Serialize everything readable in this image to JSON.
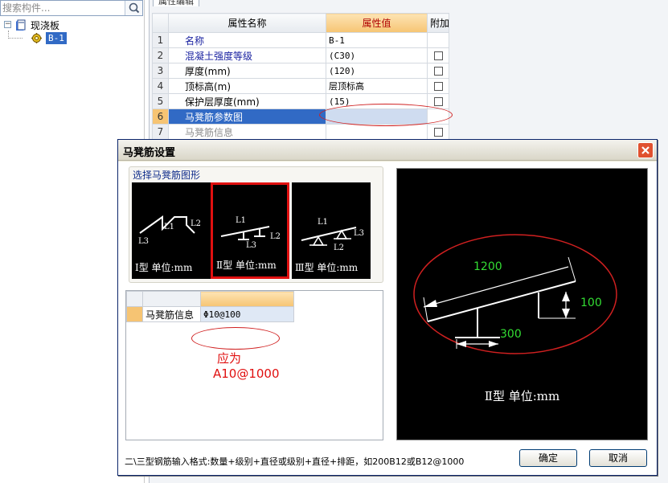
{
  "search": {
    "placeholder": "搜索构件..."
  },
  "tree": {
    "root_label": "现浇板",
    "expander": "−",
    "child_label": "B-1"
  },
  "property_panel": {
    "tab_label": "属性编辑",
    "headers": {
      "index": "",
      "name": "属性名称",
      "value": "属性值",
      "extra": "附加"
    },
    "rows": [
      {
        "index": "1",
        "name": "名称",
        "value": "B-1"
      },
      {
        "index": "2",
        "name": "混凝土强度等级",
        "value": "(C30)"
      },
      {
        "index": "3",
        "name": "厚度(mm)",
        "value": "(120)"
      },
      {
        "index": "4",
        "name": "顶标高(m)",
        "value": "层顶标高"
      },
      {
        "index": "5",
        "name": "保护层厚度(mm)",
        "value": "(15)"
      },
      {
        "index": "6",
        "name": "马凳筋参数图",
        "value": ""
      },
      {
        "index": "7",
        "name": "马凳筋信息",
        "value": ""
      }
    ]
  },
  "dialog": {
    "title": "马凳筋设置",
    "group_label": "选择马凳筋图形",
    "shapes": [
      {
        "caption": "Ⅰ型 单位:mm",
        "l1": "L1",
        "l2": "L2",
        "l3": "L3"
      },
      {
        "caption": "Ⅱ型 单位:mm",
        "l1": "L1",
        "l2": "L2",
        "l3": "L3"
      },
      {
        "caption": "Ⅲ型 单位:mm",
        "l1": "L1",
        "l2": "L2",
        "l3": "L3"
      }
    ],
    "selected_shape": 1,
    "grid": {
      "row_label": "马凳筋信息",
      "row_value": "Φ10@100"
    },
    "annotation": {
      "line1": "应为",
      "line2": "A10@1000"
    },
    "preview": {
      "caption": "Ⅱ型 单位:mm",
      "dim_length": "1200",
      "dim_height": "100",
      "dim_base": "300"
    },
    "hint": "二\\三型钢筋输入格式:数量+级别+直径或级别+直径+排距，如200B12或B12@1000",
    "ok_label": "确定",
    "cancel_label": "取消"
  },
  "colors": {
    "annotation_red": "#e01010",
    "selection_blue": "#316ac5",
    "header_orange": "#f6c473",
    "dimension_green": "#33dd33"
  }
}
